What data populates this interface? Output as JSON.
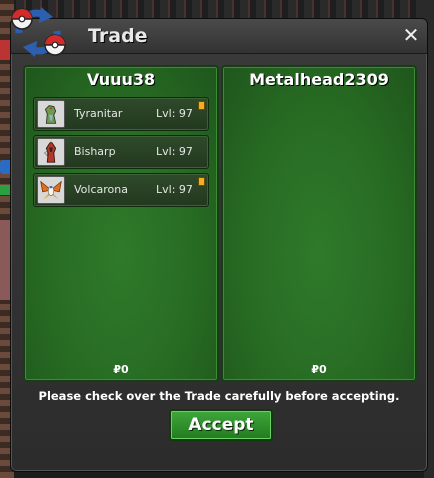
{
  "window": {
    "title": "Trade"
  },
  "left_panel": {
    "trainer": "Vuuu38",
    "money": "₽0",
    "pokemon": [
      {
        "name": "Tyranitar",
        "level": "Lvl: 97",
        "held_item": true,
        "sprite": "tyranitar-sprite"
      },
      {
        "name": "Bisharp",
        "level": "Lvl: 97",
        "held_item": false,
        "sprite": "bisharp-sprite"
      },
      {
        "name": "Volcarona",
        "level": "Lvl: 97",
        "held_item": true,
        "sprite": "volcarona-sprite"
      }
    ]
  },
  "right_panel": {
    "trainer": "Metalhead2309",
    "money": "₽0",
    "pokemon": []
  },
  "footer": {
    "notice": "Please check over the Trade carefully before accepting.",
    "accept_label": "Accept"
  },
  "colors": {
    "panel_green": "#276b23",
    "accept_green": "#2f8f2b",
    "item_badge": "#f0b020"
  }
}
